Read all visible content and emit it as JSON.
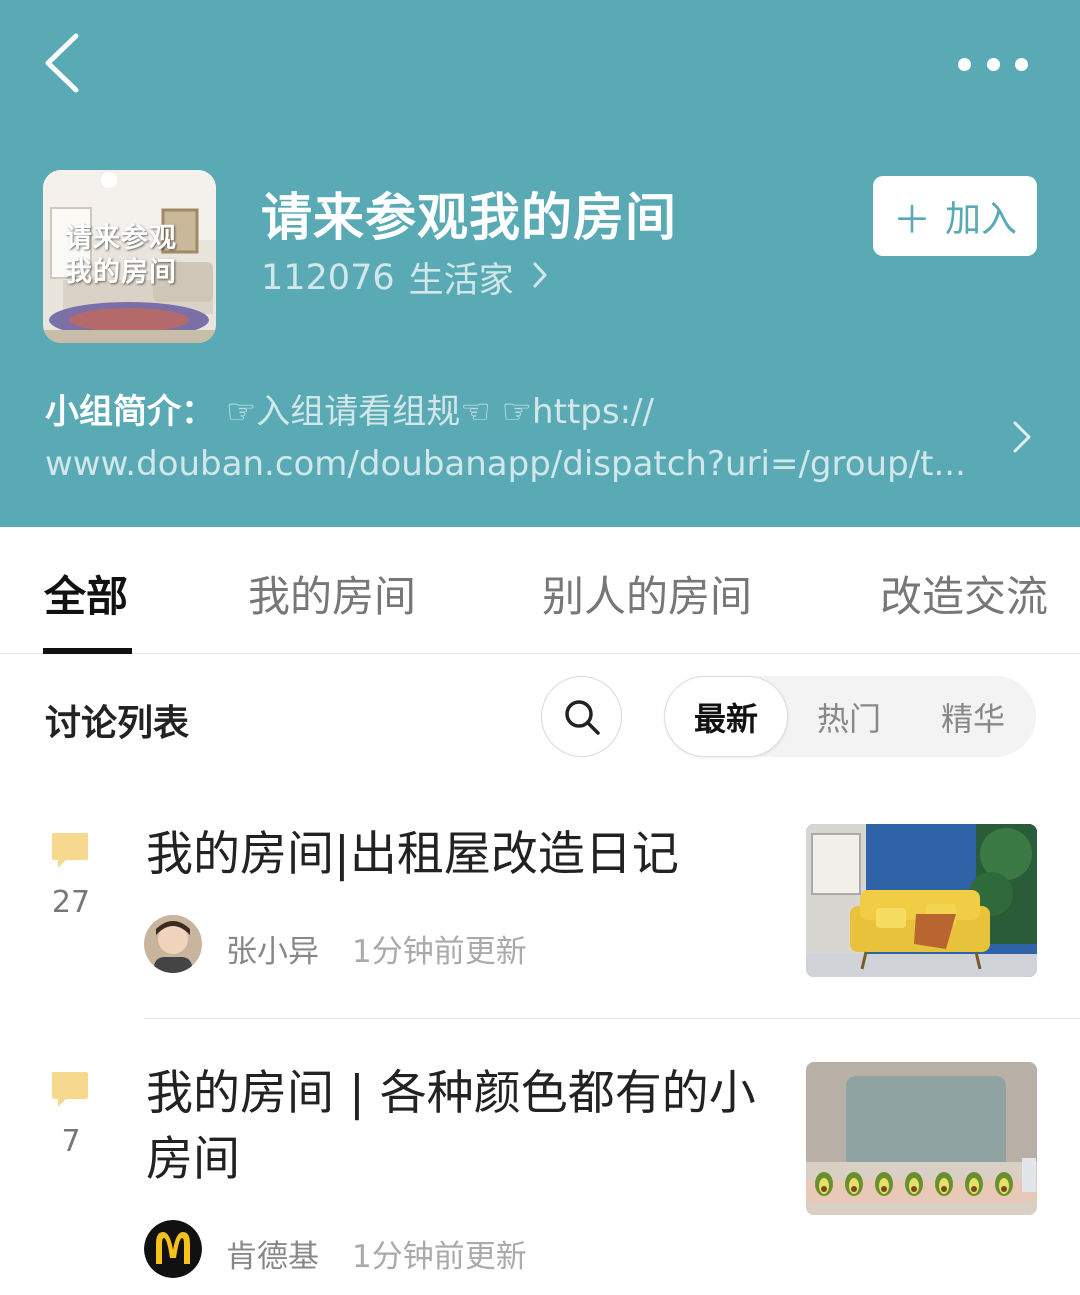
{
  "header": {
    "back_icon": "chevron-left-icon",
    "more_icon": "more-dots-icon",
    "bg_color": "#5aaab5"
  },
  "group": {
    "cover_text_line1": "请来参观",
    "cover_text_line2": "我的房间",
    "title": "请来参观我的房间",
    "member_count": "112076",
    "member_label": "生活家",
    "join_label": "加入",
    "intro_label": "小组简介：",
    "intro_text_line1": "☞入组请看组规☜ ☞https://",
    "intro_text_line2": "www.douban.com/doubanapp/dispatch?uri=/group/t..."
  },
  "tabs": [
    {
      "label": "全部",
      "active": true
    },
    {
      "label": "我的房间",
      "active": false
    },
    {
      "label": "别人的房间",
      "active": false
    },
    {
      "label": "改造交流",
      "active": false
    }
  ],
  "list": {
    "title": "讨论列表",
    "sort_options": [
      "最新",
      "热门",
      "精华"
    ],
    "active_sort": "最新"
  },
  "posts": [
    {
      "comments": "27",
      "title": "我的房间|出租屋改造日记",
      "author": "张小异",
      "updated": "1分钟前更新"
    },
    {
      "comments": "7",
      "title": "我的房间 | 各种颜色都有的小房间",
      "author": "肯德基",
      "updated": "1分钟前更新"
    }
  ]
}
